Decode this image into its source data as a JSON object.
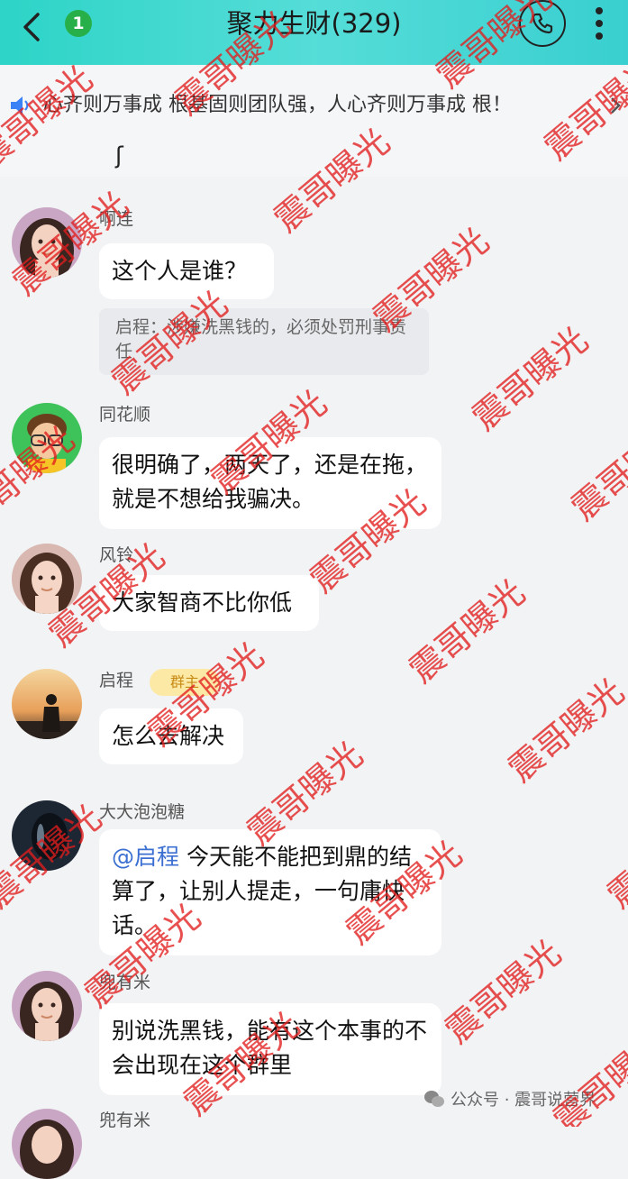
{
  "header": {
    "title": "聚力生财(329)",
    "unread_badge": "1",
    "icons": [
      "back-arrow-icon",
      "phone-icon",
      "more-vertical-icon"
    ],
    "color": "#39d2cc"
  },
  "notice": {
    "text": "心齐则万事成  根基固则团队强，人心齐则万事成  根！",
    "icon": "speaker-icon"
  },
  "stray_char": "ʃ",
  "messages": [
    {
      "name": "啊连",
      "text": "这个人是谁？",
      "quote": "启程：涉嫌洗黑钱的，必须处罚刑事责任"
    },
    {
      "name": "同花顺",
      "text": "很明确了，两天了，还是在拖，就是不想给我骗决。"
    },
    {
      "name": "风铃",
      "text": "大家智商不比你低"
    },
    {
      "name": "启程",
      "tag": "群主",
      "text": "怎么去解决"
    },
    {
      "name": "大大泡泡糖",
      "mention": "@启程",
      "text": " 今天能不能把到鼎的结算了，让别人提走，一句庸快话。"
    },
    {
      "name": "兜有米",
      "text": "别说洗黑钱，能有这个本事的不会出现在这个群里"
    },
    {
      "name": "兜有米"
    }
  ],
  "watermark": "震哥曝光",
  "footer": {
    "text": "公众号 · 震哥说营界",
    "icon": "wechat-icon"
  }
}
